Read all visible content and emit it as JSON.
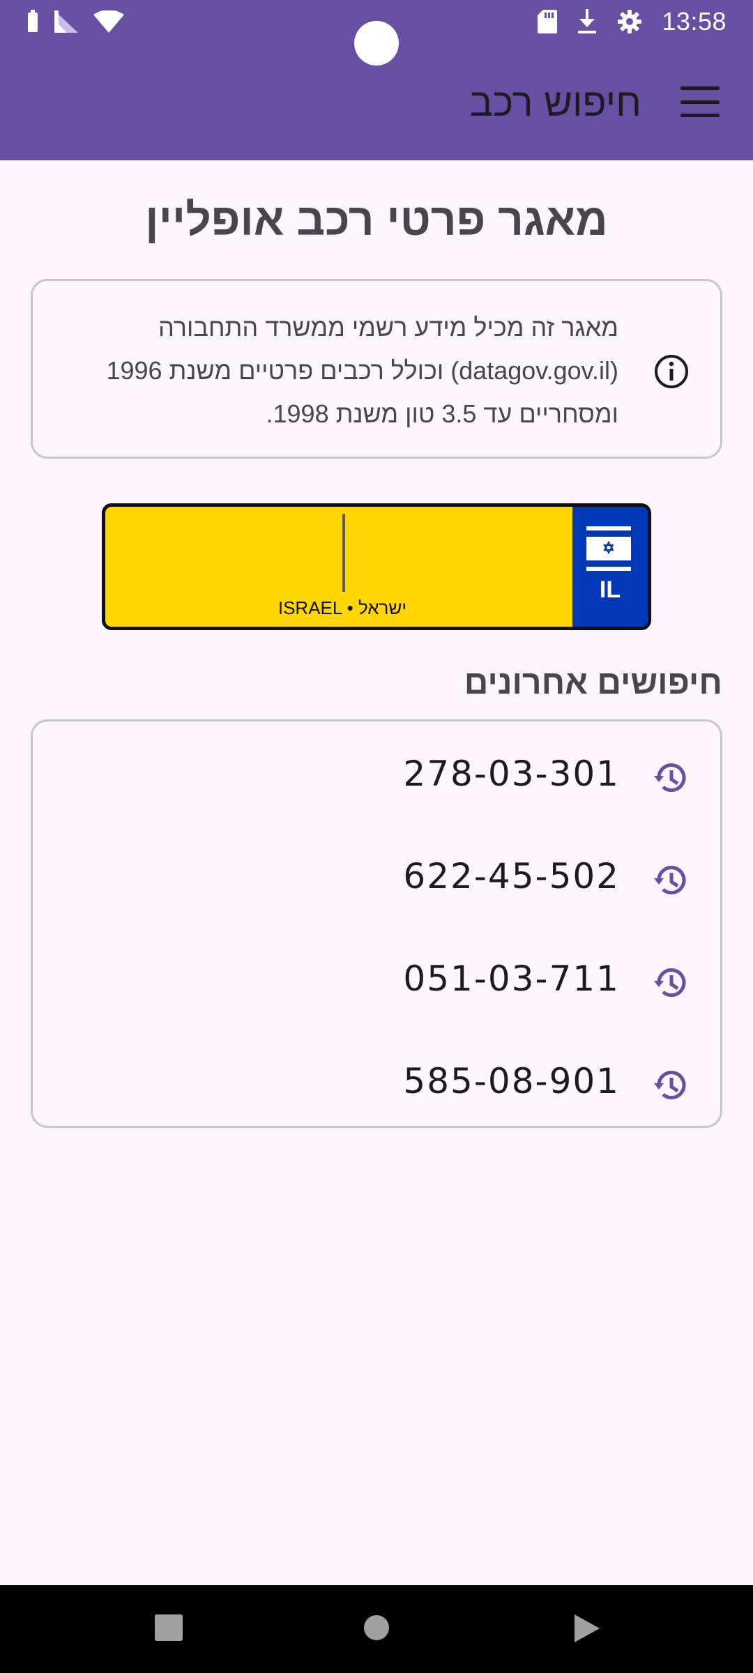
{
  "status_bar": {
    "time": "13:58",
    "left_icons": [
      "battery-icon",
      "signal-icon",
      "wifi-icon"
    ],
    "right_icons": [
      "sd-card-icon",
      "download-icon",
      "settings-icon"
    ]
  },
  "app_bar": {
    "title": "חיפוש רכב",
    "menu_icon": "hamburger-menu-icon",
    "background_color": "#6750a4"
  },
  "main": {
    "title": "מאגר פרטי רכב אופליין",
    "info": {
      "icon": "info-icon",
      "lines": [
        "מאגר זה מכיל מידע רשמי ממשרד התחבורה",
        "(datagov.gov.il) וכולל רכבים פרטיים משנת 1996",
        "ומסחריים עד 3.5 טון משנת 1998."
      ]
    },
    "plate_input": {
      "value": "",
      "caption": "ISRAEL • ישראל",
      "country_code": "IL",
      "plate_color": "#ffd700",
      "band_color": "#0038b8"
    },
    "recent": {
      "heading": "חיפושים אחרונים",
      "items": [
        {
          "plate": "278-03-301",
          "icon": "history-icon"
        },
        {
          "plate": "622-45-502",
          "icon": "history-icon"
        },
        {
          "plate": "051-03-711",
          "icon": "history-icon"
        },
        {
          "plate": "585-08-901",
          "icon": "history-icon"
        }
      ]
    }
  },
  "nav_bar": {
    "buttons": [
      "recents-square-icon",
      "home-circle-icon",
      "back-triangle-icon"
    ]
  }
}
